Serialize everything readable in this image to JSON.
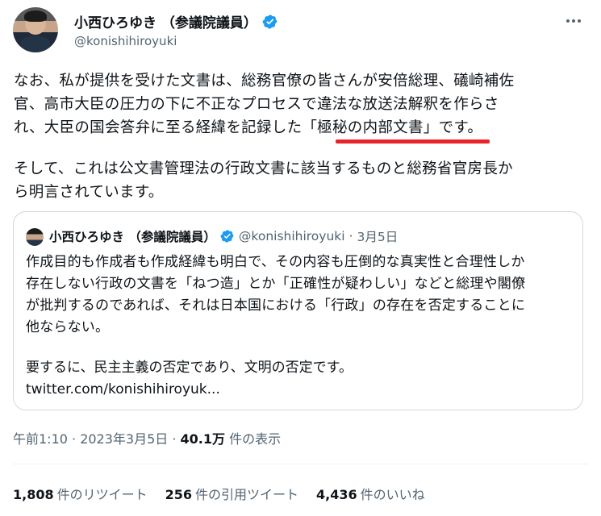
{
  "tweet": {
    "author": {
      "name": "小西ひろゆき （参議院議員）",
      "handle": "@konishihiroyuki"
    },
    "text_lines": [
      "なお、私が提供を受けた文書は、総務官僚の皆さんが安倍総理、礒崎補佐",
      "官、高市大臣の圧力の下に不正なプロセスで違法な放送法解釈を作らさ",
      "れ、大臣の国会答弁に至る経緯を記録した「極秘の内部文書」です。"
    ],
    "text_lines_2": [
      "そして、これは公文書管理法の行政文書に該当するものと総務省官房長か",
      "ら明言されています。"
    ],
    "timestamp": "午前1:10 · 2023年3月5日 · ",
    "views_count": "40.1万",
    "views_label": " 件の表示",
    "annotation_color": "#e8232a"
  },
  "quote": {
    "author": {
      "name": "小西ひろゆき （参議院議員）",
      "handle": "@konishihiroyuki",
      "separator": "·",
      "date": "3月5日"
    },
    "text_lines": [
      "作成目的も作成者も作成経緯も明白で、その内容も圧倒的な真実性と合理性しか",
      "存在しない行政の文書を「ねつ造」とか「正確性が疑わしい」などと総理や閣僚",
      "が批判するのであれば、それは日本国における「行政」の存在を否定することに",
      "他ならない。"
    ],
    "text_lines_2": [
      "要するに、民主主義の否定であり、文明の否定です。",
      "twitter.com/konishihiroyuk..."
    ]
  },
  "stats": {
    "retweets_count": "1,808",
    "retweets_label": "件のリツイート",
    "quotes_count": "256",
    "quotes_label": "件の引用ツイート",
    "likes_count": "4,436",
    "likes_label": "件のいいね"
  },
  "colors": {
    "verified": "#1d9bf0",
    "text": "#0f1419",
    "secondary": "#536471"
  }
}
